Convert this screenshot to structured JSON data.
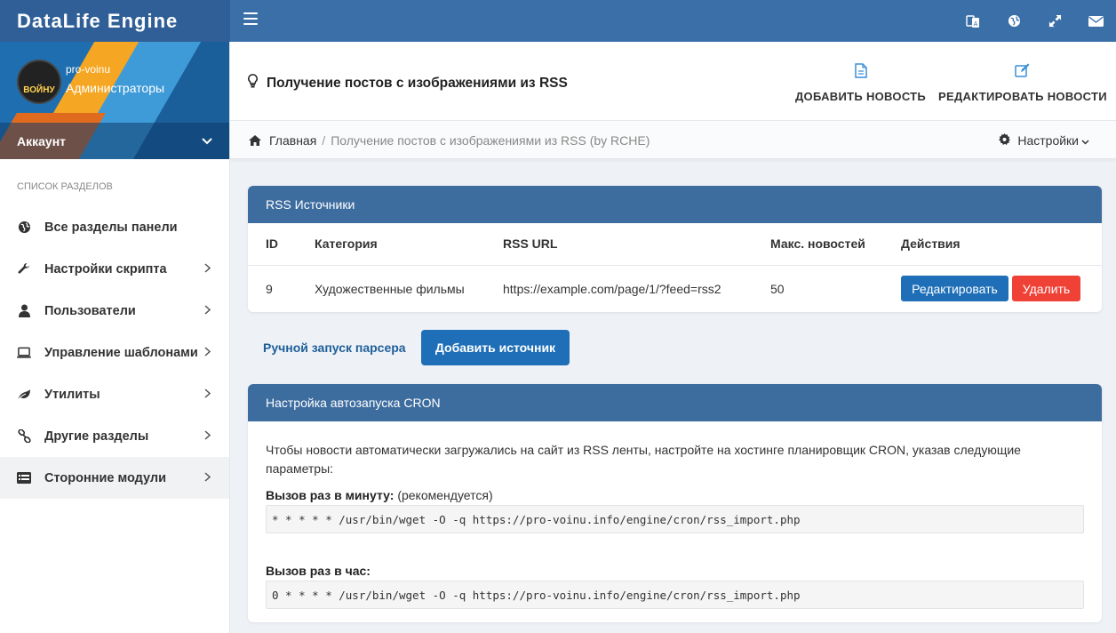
{
  "topbar": {
    "brand": "DataLife Engine",
    "icons": [
      "translate-icon",
      "globe-icon",
      "expand-icon",
      "mail-icon"
    ]
  },
  "sidebar": {
    "username": "pro-voinu",
    "role": "Администраторы",
    "account_label": "Аккаунт",
    "avatar_text": "ВОЙНУ",
    "section_heading": "Список разделов",
    "items": [
      {
        "label": "Все разделы панели",
        "icon": "globe-icon",
        "has_arrow": false
      },
      {
        "label": "Настройки скрипта",
        "icon": "wrench-icon",
        "has_arrow": true
      },
      {
        "label": "Пользователи",
        "icon": "user-icon",
        "has_arrow": true
      },
      {
        "label": "Управление шаблонами",
        "icon": "laptop-icon",
        "has_arrow": true
      },
      {
        "label": "Утилиты",
        "icon": "leaf-icon",
        "has_arrow": true
      },
      {
        "label": "Другие разделы",
        "icon": "link-icon",
        "has_arrow": true
      },
      {
        "label": "Сторонние модули",
        "icon": "list-icon",
        "has_arrow": true,
        "active": true
      }
    ]
  },
  "header": {
    "title": "Получение постов с изображениями из RSS",
    "add_news": "ДОБАВИТЬ НОВОСТЬ",
    "edit_news": "РЕДАКТИРОВАТЬ НОВОСТИ"
  },
  "breadcrumb": {
    "home": "Главная",
    "separator": "/",
    "current": "Получение постов с изображениями из RSS (by RCHE)",
    "settings": "Настройки"
  },
  "rss_panel": {
    "title": "RSS Источники",
    "columns": [
      "ID",
      "Категория",
      "RSS URL",
      "Макс. новостей",
      "Действия"
    ],
    "rows": [
      {
        "id": "9",
        "category": "Художественные фильмы",
        "url": "https://example.com/page/1/?feed=rss2",
        "max": "50"
      }
    ],
    "edit_label": "Редактировать",
    "delete_label": "Удалить"
  },
  "actions": {
    "manual_run": "Ручной запуск парсера",
    "add_source": "Добавить источник"
  },
  "cron_panel": {
    "title": "Настройка автозапуска CRON",
    "description": "Чтобы новости автоматически загружались на сайт из RSS ленты, настройте на хостинге планировщик CRON, указав следующие параметры:",
    "minute_label": "Вызов раз в минуту:",
    "minute_note": " (рекомендуется)",
    "minute_cmd": "* * * * * /usr/bin/wget -O -q https://pro-voinu.info/engine/cron/rss_import.php",
    "hour_label": "Вызов раз в час:",
    "hour_cmd": "0 * * * * /usr/bin/wget -O -q https://pro-voinu.info/engine/cron/rss_import.php"
  },
  "colors": {
    "topbar": "#3a6fa8",
    "brand_bg": "#2f5f96",
    "panel_header": "#3d6c9f",
    "primary_button": "#1e6fb7",
    "danger_button": "#ef4136",
    "link": "#1e5f99"
  }
}
